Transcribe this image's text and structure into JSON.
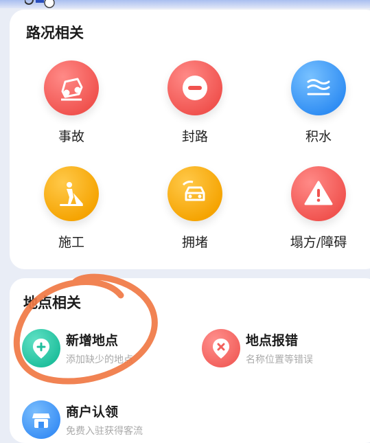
{
  "road_section": {
    "title": "路况相关",
    "items": [
      {
        "label": "事故",
        "icon": "car-accident-icon",
        "color": "#f0524e"
      },
      {
        "label": "封路",
        "icon": "road-closed-icon",
        "color": "#f0524e"
      },
      {
        "label": "积水",
        "icon": "water-icon",
        "color": "#2f8df3"
      },
      {
        "label": "施工",
        "icon": "construction-icon",
        "color": "#f5a300"
      },
      {
        "label": "拥堵",
        "icon": "traffic-jam-icon",
        "color": "#f5a300"
      },
      {
        "label": "塌方/障碍",
        "icon": "warning-icon",
        "color": "#f0524e"
      }
    ]
  },
  "place_section": {
    "title": "地点相关",
    "items": [
      {
        "title": "新增地点",
        "subtitle": "添加缺少的地点",
        "icon": "add-location-icon",
        "color": "#1fbf9c"
      },
      {
        "title": "地点报错",
        "subtitle": "名称位置等错误",
        "icon": "location-error-icon",
        "color": "#f2605c"
      },
      {
        "title": "商户认领",
        "subtitle": "免费入驻获得客流",
        "icon": "store-icon",
        "color": "#3a8ff5"
      }
    ]
  },
  "colors": {
    "annotation": "#f07844",
    "background": "#e9edf6"
  }
}
